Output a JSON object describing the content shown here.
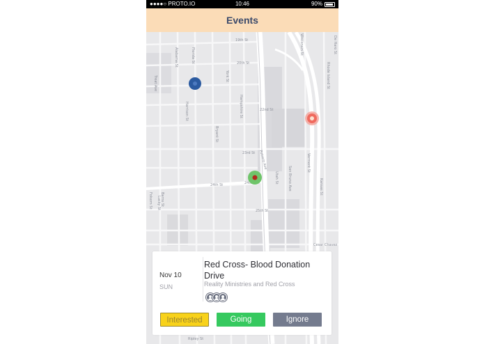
{
  "status_bar": {
    "carrier": "●●●●○ PROTO.IO",
    "time": "10:46",
    "battery": "90%"
  },
  "header": {
    "title": "Events"
  },
  "map": {
    "street_labels": [
      "19th St",
      "20th St",
      "22nd St",
      "23rd St",
      "24th St",
      "24th St",
      "25th St",
      "Cesar Chavez",
      "Alabama St",
      "Florida St",
      "Bryant St",
      "York St",
      "Hampshire St",
      "Harrison St",
      "Treat Ave",
      "Folsom St",
      "Potrero Ave",
      "Utah St",
      "San Bruno Ave",
      "Vermont St",
      "Kansas St",
      "Rhode Island St",
      "De Haro St",
      "Wisconsin St",
      "Barns St",
      "Lucky St",
      "Ripley St"
    ],
    "markers": [
      {
        "name": "blue-marker",
        "color": "#2b5aa0"
      },
      {
        "name": "orange-marker",
        "color": "#f06a5e"
      },
      {
        "name": "green-marker",
        "color": "#6fc46a"
      }
    ]
  },
  "event": {
    "date": "Nov 10",
    "day": "SUN",
    "title": "Red Cross- Blood Donation Drive",
    "organizer": "Reality Ministries and Red Cross",
    "attendee_icons": [
      "person-icon",
      "person-icon",
      "person-icon"
    ]
  },
  "actions": {
    "interested": "Interested",
    "going": "Going",
    "ignore": "Ignore"
  },
  "colors": {
    "header_bg": "#fbdcb7",
    "interested": "#f8d21a",
    "going": "#36c95f",
    "ignore": "#747b8e"
  }
}
